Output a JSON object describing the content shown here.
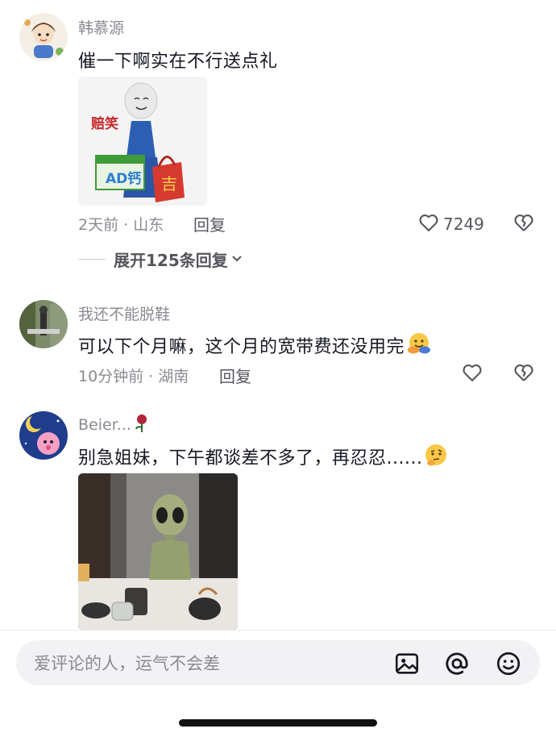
{
  "comments": [
    {
      "username": "韩慕源",
      "text": "催一下啊实在不行送点礼",
      "image_caption": "赔笑",
      "bag_char": "吉",
      "box_label": "AD钙",
      "time_location": "2天前 · 山东",
      "reply_label": "回复",
      "like_count": "7249"
    },
    {
      "username": "我还不能脱鞋",
      "text": "可以下个月嘛，这个月的宽带费还没用完",
      "time_location": "10分钟前 · 湖南",
      "reply_label": "回复",
      "like_count": ""
    },
    {
      "username": "Beier...",
      "text": "别急姐妹，下午都谈差不多了，再忍忍......"
    }
  ],
  "expand_replies": "展开125条回复",
  "input": {
    "placeholder": "爱评论的人，运气不会差"
  },
  "icons": {
    "like": "heart-outline-icon",
    "dislike": "broken-heart-icon",
    "image": "image-icon",
    "mention": "at-icon",
    "emoji": "smiley-icon",
    "expand": "chevron-down-icon"
  }
}
